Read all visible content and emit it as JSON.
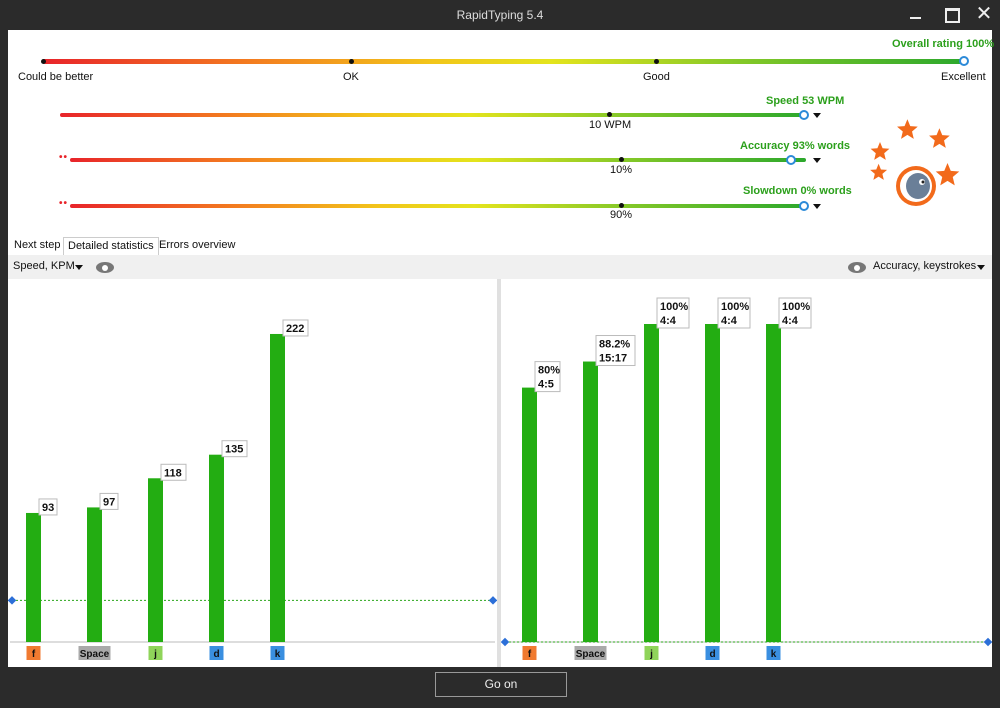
{
  "window": {
    "title": "RapidTyping 5.4"
  },
  "overall": {
    "label": "Overall rating 100%",
    "scale": [
      "Could be better",
      "OK",
      "Good",
      "Excellent"
    ],
    "value_pct": 100
  },
  "metrics": [
    {
      "label": "Speed 53 WPM",
      "marker": "10 WPM"
    },
    {
      "label": "Accuracy 93% words",
      "marker": "10%"
    },
    {
      "label": "Slowdown 0% words",
      "marker": "90%"
    }
  ],
  "tabs": [
    {
      "label": "Next step"
    },
    {
      "label": "Detailed statistics"
    },
    {
      "label": "Errors overview"
    }
  ],
  "toolbar": {
    "left_select": "Speed, KPM",
    "right_select": "Accuracy, keystrokes"
  },
  "chart_data": [
    {
      "type": "bar",
      "categories": [
        "f",
        "Space",
        "j",
        "d",
        "k"
      ],
      "values": [
        93,
        97,
        118,
        135,
        222
      ],
      "labels": [
        "93",
        "97",
        "118",
        "135",
        "222"
      ],
      "ylim": [
        0,
        240
      ],
      "reference_line": 30,
      "bar_color": "#23ad12"
    },
    {
      "type": "bar",
      "categories": [
        "f",
        "Space",
        "j",
        "d",
        "k"
      ],
      "values": [
        80,
        88.2,
        100,
        100,
        100
      ],
      "labels": [
        [
          "80%",
          "4:5"
        ],
        [
          "88.2%",
          "15:17"
        ],
        [
          "100%",
          "4:4"
        ],
        [
          "100%",
          "4:4"
        ],
        [
          "100%",
          "4:4"
        ]
      ],
      "ylim": [
        0,
        100
      ],
      "reference_line": 0,
      "bar_color": "#23ad12"
    }
  ],
  "key_colors": {
    "f": "#f07a30",
    "Space": "#a9a9a9",
    "j": "#8fd45a",
    "d": "#3a8fe0",
    "k": "#3a8fe0"
  },
  "footer": {
    "button": "Go on"
  }
}
